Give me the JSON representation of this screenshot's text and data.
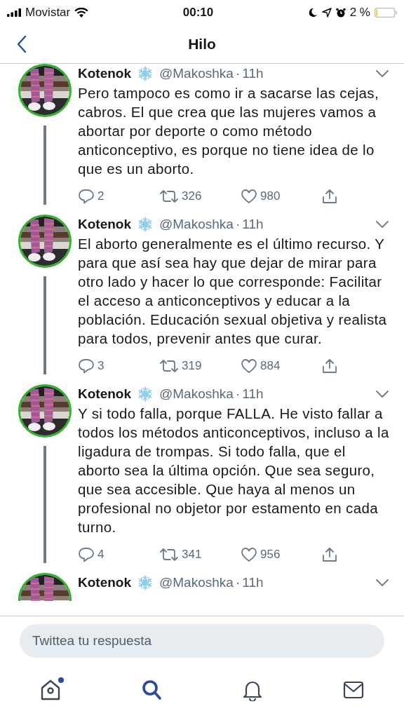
{
  "status_bar": {
    "carrier": "Movistar",
    "time": "00:10",
    "battery": "2 %"
  },
  "header": {
    "title": "Hilo"
  },
  "tweets": [
    {
      "name": "Kotenok",
      "handle": "@Makoshka",
      "dot": "·",
      "time": "11h",
      "text": "Pero tampoco es como ir a sacarse las cejas, cabros. El que crea que las mujeres vamos a abortar por deporte o como método anticonceptivo, es porque no tiene idea de lo que es un aborto.",
      "replies": "2",
      "retweets": "326",
      "likes": "980"
    },
    {
      "name": "Kotenok",
      "handle": "@Makoshka",
      "dot": "·",
      "time": "11h",
      "text": "El aborto generalmente es el último recurso. Y para que así sea hay que dejar de mirar para otro lado y hacer lo que corresponde: Facilitar el acceso a anticonceptivos y educar a la población. Educación sexual objetiva y realista para todos, prevenir antes que curar.",
      "replies": "3",
      "retweets": "319",
      "likes": "884"
    },
    {
      "name": "Kotenok",
      "handle": "@Makoshka",
      "dot": "·",
      "time": "11h",
      "text": "Y si todo falla, porque FALLA. He visto fallar a todos los métodos anticonceptivos, incluso a la ligadura de trompas. Si todo falla, que el aborto sea la última opción. Que sea seguro, que sea accesible. Que haya al menos un profesional no objetor por estamento en cada turno.",
      "replies": "4",
      "retweets": "341",
      "likes": "956"
    },
    {
      "name": "Kotenok",
      "handle": "@Makoshka",
      "dot": "·",
      "time": "11h"
    }
  ],
  "reply": {
    "placeholder": "Twittea tu respuesta"
  },
  "tabs": [
    {
      "kind": "home",
      "selected": false,
      "has_new": true
    },
    {
      "kind": "search",
      "selected": true,
      "has_new": false
    },
    {
      "kind": "bell",
      "selected": false,
      "has_new": false
    },
    {
      "kind": "mail",
      "selected": false,
      "has_new": false
    }
  ]
}
